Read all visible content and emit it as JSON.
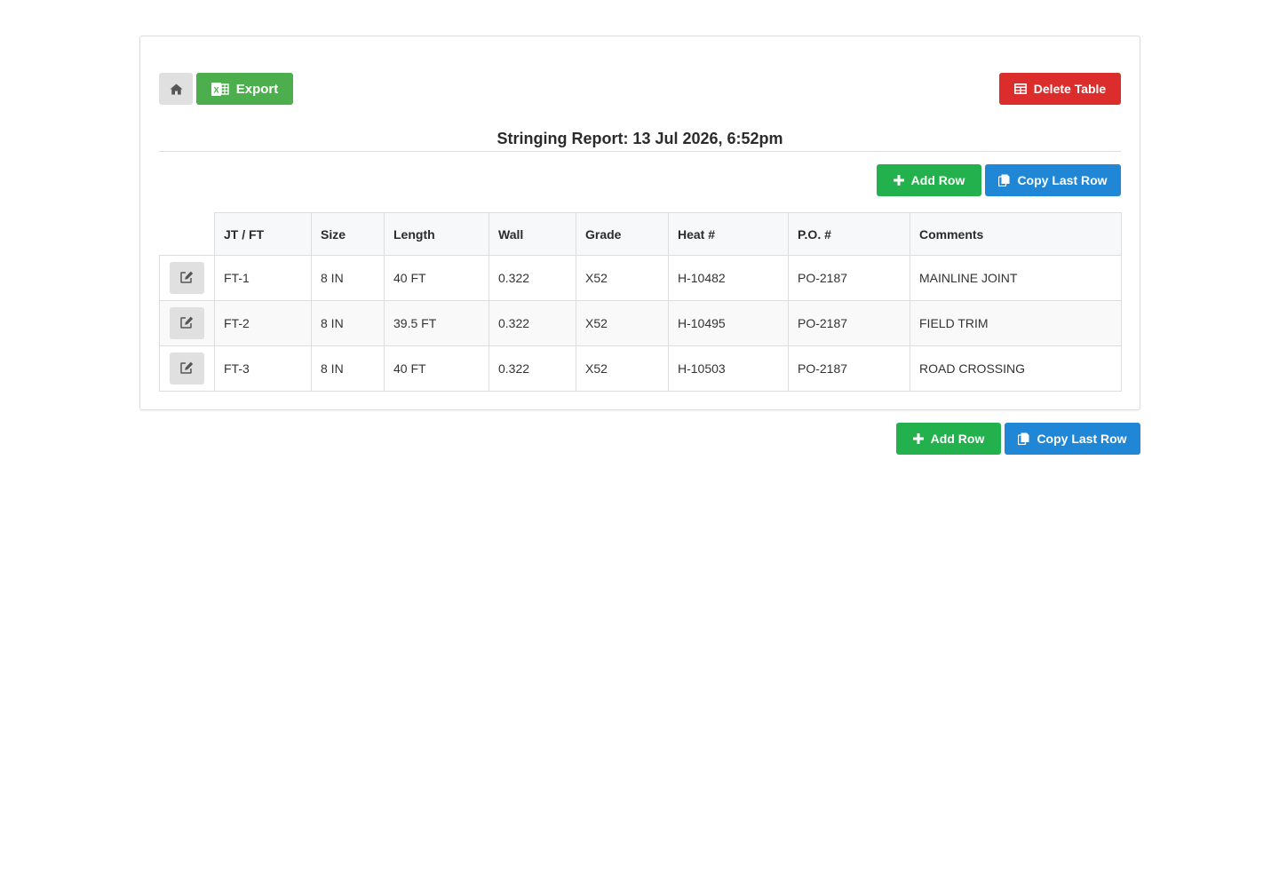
{
  "toolbar": {
    "export_label": "Export",
    "delete_label": "Delete Table"
  },
  "report": {
    "title": "Stringing Report: 13 Jul 2026, 6:52pm"
  },
  "actions": {
    "add_row_label": "Add Row",
    "copy_last_row_label": "Copy Last Row"
  },
  "table": {
    "headers": [
      "JT / FT",
      "Size",
      "Length",
      "Wall",
      "Grade",
      "Heat #",
      "P.O. #",
      "Comments"
    ],
    "rows": [
      [
        "FT-1",
        "8 IN",
        "40 FT",
        "0.322",
        "X52",
        "H-10482",
        "PO-2187",
        "MAINLINE JOINT"
      ],
      [
        "FT-2",
        "8 IN",
        "39.5 FT",
        "0.322",
        "X52",
        "H-10495",
        "PO-2187",
        "FIELD TRIM"
      ],
      [
        "FT-3",
        "8 IN",
        "40 FT",
        "0.322",
        "X52",
        "H-10503",
        "PO-2187",
        "ROAD CROSSING"
      ]
    ]
  },
  "icons": {
    "home": "home-icon",
    "export": "excel-icon",
    "delete": "table-icon",
    "add": "plus-icon",
    "copy": "copy-icon",
    "edit": "edit-icon"
  },
  "colors": {
    "export": "#4cae4c",
    "delete": "#dc2d2d",
    "add": "#22b14c",
    "copy": "#1f87d6"
  }
}
